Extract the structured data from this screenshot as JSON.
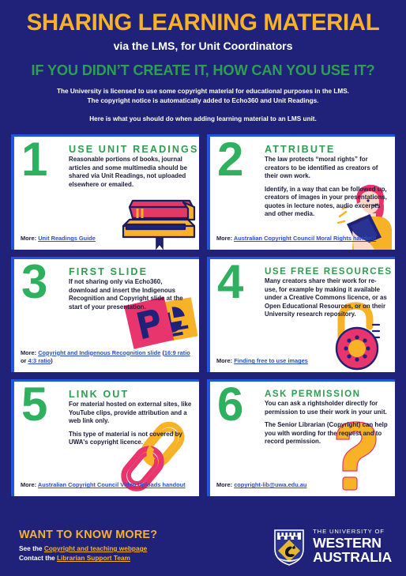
{
  "header": {
    "title": "SHARING LEARNING MATERIAL",
    "subtitle": "via the LMS, for Unit Coordinators",
    "tagline": "IF YOU DIDN’T CREATE IT, HOW CAN YOU USE IT?",
    "intro_line1": "The University is licensed to use some copyright material for educational purposes in the LMS.",
    "intro_line2": "The copyright notice is automatically added to Echo360 and Unit Readings.",
    "intro_line3": "Here is what you should do when adding learning material to an LMS unit."
  },
  "cards": [
    {
      "number": "1",
      "heading": "USE UNIT READINGS",
      "body1": "Reasonable portions of books, journal articles and some multimedia should be shared via Unit Readings, not uploaded elsewhere or emailed.",
      "body2": "",
      "more_label": "More:",
      "link1": "Unit Readings Guide",
      "link2": "",
      "icon": "stack-of-books-illustration"
    },
    {
      "number": "2",
      "heading": "ATTRIBUTE",
      "body1": "The law protects “moral rights” for creators to be identified as creators of their own work.",
      "body2": "Identify, in a way that can be followed up, creators of images in your presentations, quotes in lecture notes, audio excerpts and other media.",
      "more_label": "More:",
      "link1": "Australian Copyright Council Moral Rights handout",
      "link2": "",
      "icon": "woman-with-tablet-illustration"
    },
    {
      "number": "3",
      "heading": "FIRST SLIDE",
      "body1": "If not sharing only via Echo360, download and insert the Indigenous Recognition and Copyright slide at the start of your presentation.",
      "body2": "",
      "more_label": "More:",
      "link1": "Copyright and Indigenous Recognition slide",
      "link_ratio_1": "16:9 ratio",
      "link_ratio_sep": "or",
      "link_ratio_2": "4:3 ratio",
      "icon": "powerpoint-slides-illustration"
    },
    {
      "number": "4",
      "heading": "USE FREE RESOURCES",
      "body1": "Many creators share their work for re-use, for example by making it available under a Creative Commons licence, or as Open Educational Resources, or on their University research repository.",
      "body2": "",
      "more_label": "More:",
      "link1": "Finding free to use images",
      "link2": "",
      "icon": "open-padlock-illustration"
    },
    {
      "number": "5",
      "heading": "LINK OUT",
      "body1": "For material hosted on external sites, like YouTube clips, provide attribution and a web link only.",
      "body2": "This type of material is not covered by UWA's copyright licence.",
      "more_label": "More:",
      "link1": "Australian Copyright Council Video Uploads handout",
      "link2": "",
      "icon": "paperclip-chain-illustration"
    },
    {
      "number": "6",
      "heading": "ASK PERMISSION",
      "body1": "You can ask a rightsholder directly for permission to use their work in your unit.",
      "body2": "The Senior Librarian (Copyright) can help you with wording for the request and to record permission.",
      "more_label": "More:",
      "link1": "copyright-lib@uwa.edu.au",
      "link2": "",
      "icon": "question-mark-illustration"
    }
  ],
  "footer": {
    "title": "WANT TO KNOW MORE?",
    "see_prefix": "See the",
    "see_link": "Copyright and teaching webpage",
    "contact_prefix": "Contact the",
    "contact_link": "Librarian Support Team",
    "logo_line1": "THE UNIVERSITY OF",
    "logo_line2": "WESTERN",
    "logo_line3": "AUSTRALIA",
    "logo_icon": "uwa-crest-icon"
  },
  "colors": {
    "background": "#1F2278",
    "gold": "#F7B227",
    "green": "#2E9E4F",
    "number_green": "#2FB05E",
    "card_border_blue": "#2255DD",
    "link_blue": "#2A4ED0",
    "crimson": "#E23A64",
    "card_bg": "#FFFFFF"
  }
}
